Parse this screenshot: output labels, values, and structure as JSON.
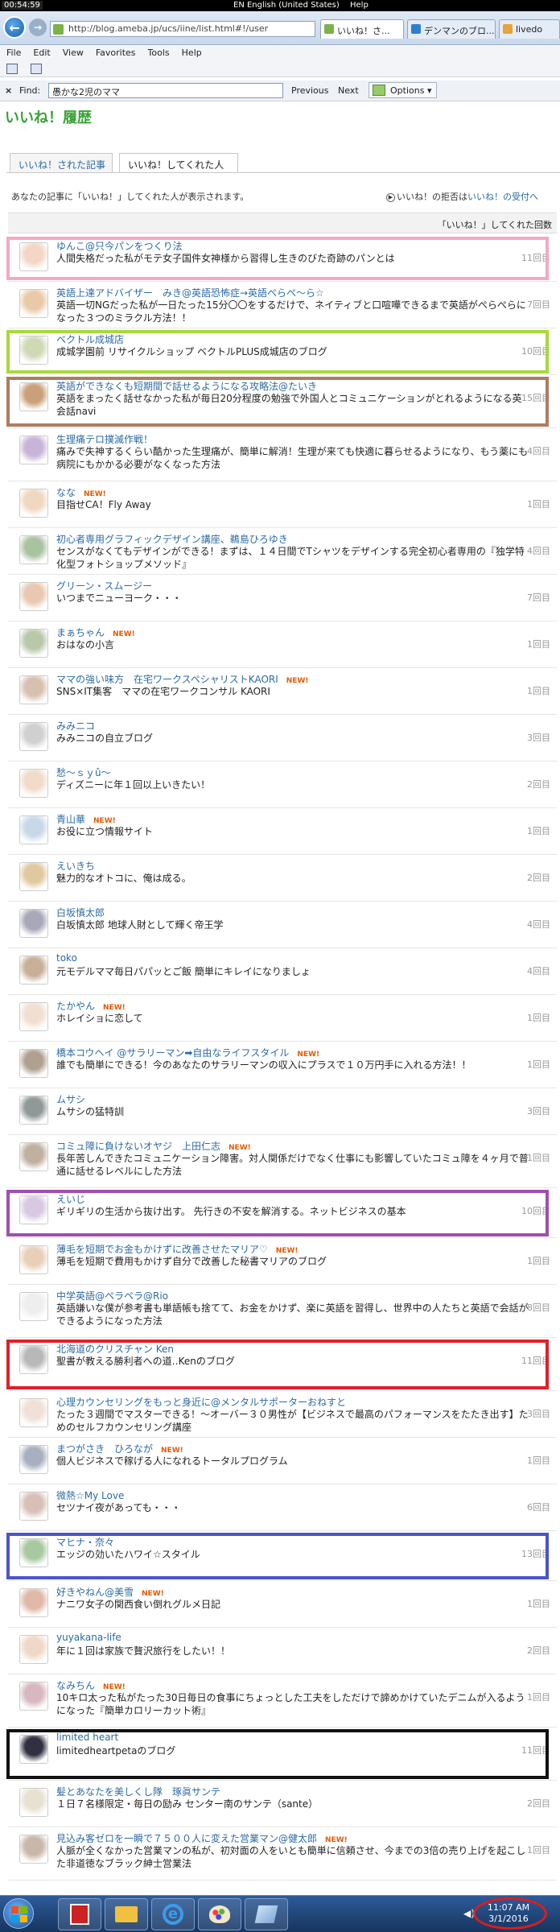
{
  "system": {
    "time_top": "00:54:59",
    "lang": "EN English (United States)",
    "help": "Help"
  },
  "browser": {
    "url": "http://blog.ameba.jp/ucs/iine/list.html#!/user",
    "tabs": [
      "いいね！さ...",
      "デンマンのブロ...",
      "livedo"
    ],
    "menu": [
      "File",
      "Edit",
      "View",
      "Favorites",
      "Tools",
      "Help"
    ],
    "find": {
      "label": "Find:",
      "value": "愚かな2児のママ",
      "previous": "Previous",
      "next": "Next",
      "options": "Options"
    }
  },
  "page": {
    "brand": "いいね！履歴",
    "tab_received": "いいね！された記事",
    "tab_given": "いいね！してくれた人",
    "description": "あなたの記事に「いいね！」してくれた人が表示されます。",
    "reject_prefix": "いいね！の拒否は",
    "reject_link": "いいね！の受付へ",
    "header_count": "「いいね！」してくれた回数"
  },
  "users": [
    {
      "name": "ゆんこ@只今パンをつくり法",
      "new": "",
      "text": "人間失格だった私がモテ女子国件女神様から習得し生きのびた奇跡のパンとは",
      "count": "11回目",
      "highlight": "#f4a8c4",
      "av": "#f3d6c6"
    },
    {
      "name": "英語上達アドバイザー　みき@英語恐怖症→英語ぺらぺ～ら☆",
      "new": "",
      "text": "英語一切NGだった私が一日たった15分〇〇をするだけで、ネイティブと口喧嘩できるまで英語がぺらぺらになった３つのミラクル方法！！",
      "count": "7回目",
      "highlight": "",
      "av": "#e9c9a8"
    },
    {
      "name": "ベクトル成城店",
      "new": "",
      "text": "成城学園前 リサイクルショップ ベクトルPLUS成城店のブログ",
      "count": "10回目",
      "highlight": "#a8d93b",
      "av": "#cfd9b6"
    },
    {
      "name": "英語ができなくも短期間で話せるようになる攻略法@たいき",
      "new": "",
      "text": "英語をまったく話せなかった私が毎日20分程度の勉強で外国人とコミュニケーションがとれるようになる英会話navi",
      "count": "15回目",
      "highlight": "#b07c5e",
      "av": "#c9a07a"
    },
    {
      "name": "生理痛テロ撲滅作戦！",
      "new": "",
      "text": "痛みで失神するくらい酷かった生理痛が、簡単に解消！生理が来ても快適に暮らせるようになり、もう薬にも病院にもかかる必要がなくなった方法",
      "count": "4回目",
      "highlight": "",
      "av": "#c8b4d8"
    },
    {
      "name": "なな",
      "new": "NEW!",
      "text": "目指せCA！Fly Away",
      "count": "1回目",
      "highlight": "",
      "av": "#f0d7c0"
    },
    {
      "name": "初心者専用グラフィックデザイン講座、鵜島ひろゆき",
      "new": "",
      "text": "センスがなくてもデザインができる！まずは、１４日間でTシャツをデザインする完全初心者専用の『独学特化型フォトショップメソッド』",
      "count": "4回目",
      "highlight": "",
      "av": "#a9c3a1"
    },
    {
      "name": "グリーン・スムージー",
      "new": "",
      "text": "いつまでニューヨーク・・・",
      "count": "7回目",
      "highlight": "",
      "av": "#e8c8b0"
    },
    {
      "name": "まぁちゃん",
      "new": "NEW!",
      "text": "おはなの小言",
      "count": "1回目",
      "highlight": "",
      "av": "#b8c8a8"
    },
    {
      "name": "ママの強い味方　在宅ワークスペシャリストKAORI",
      "new": "NEW!",
      "text": "SNS×IT集客　ママの在宅ワークコンサル KAORI",
      "count": "1回目",
      "highlight": "",
      "av": "#d8c0b0"
    },
    {
      "name": "みみニコ",
      "new": "",
      "text": "みみニコの自立ブログ",
      "count": "3回目",
      "highlight": "",
      "av": "#d0d0d0"
    },
    {
      "name": "愁～ｓｙû～",
      "new": "",
      "text": "ディズニーに年１回以上いきたい！",
      "count": "2回目",
      "highlight": "",
      "av": "#f0dcc8"
    },
    {
      "name": "青山華",
      "new": "NEW!",
      "text": "お役に立つ情報サイト",
      "count": "1回目",
      "highlight": "",
      "av": "#c8d8e8"
    },
    {
      "name": "えいきち",
      "new": "",
      "text": "魅力的なオトコに、俺は成る。",
      "count": "2回目",
      "highlight": "",
      "av": "#e0c8a0"
    },
    {
      "name": "白坂慎太郎",
      "new": "",
      "text": "白坂慎太郎 地球人財として輝く帝王学",
      "count": "4回目",
      "highlight": "",
      "av": "#a8a8b8"
    },
    {
      "name": "toko",
      "new": "",
      "text": "元モデルママ毎日パパッとご飯 簡単にキレイになりましょ",
      "count": "4回目",
      "highlight": "",
      "av": "#c8b098"
    },
    {
      "name": "たかやん",
      "new": "NEW!",
      "text": "ホレイショに恋して",
      "count": "1回目",
      "highlight": "",
      "av": "#f0e0d0"
    },
    {
      "name": "橋本コウヘイ @サラリーマン➡自由なライフスタイル",
      "new": "NEW!",
      "text": "誰でも簡単にできる！今のあなたのサラリーマンの収入にプラスで１０万円手に入れる方法！！",
      "count": "1回目",
      "highlight": "",
      "av": "#b0a090"
    },
    {
      "name": "ムサシ",
      "new": "",
      "text": "ムサシの猛特訓",
      "count": "3回目",
      "highlight": "",
      "av": "#909898"
    },
    {
      "name": "コミュ障に負けないオヤジ　上田仁志",
      "new": "NEW!",
      "text": "長年苦しんできたコミュニケーション障害。対人関係だけでなく仕事にも影響していたコミュ障を４ヶ月で普通に話せるレベルにした方法",
      "count": "1回目",
      "highlight": "",
      "av": "#c0b0a0"
    },
    {
      "name": "えいじ",
      "new": "",
      "text": "ギリギリの生活から抜け出す。 先行きの不安を解消する。ネットビジネスの基本",
      "count": "10回目",
      "highlight": "#a04fb0",
      "av": "#d8c8e0"
    },
    {
      "name": "薄毛を短期でお金もかけずに改善させたマリア♡",
      "new": "NEW!",
      "text": "薄毛を短期で費用もかけず自分で改善した秘書マリアのブログ",
      "count": "1回目",
      "highlight": "",
      "av": "#e8d0b8"
    },
    {
      "name": "中学英語@ペラペラ@Rio",
      "new": "",
      "text": "英語嫌いな僕が参考書も単語帳も捨てて、お金をかけず、楽に英語を習得し、世界中の人たちと英語で会話ができるようになった方法",
      "count": "8回目",
      "highlight": "",
      "av": "#eeeeee"
    },
    {
      "name": "北海道のクリスチャン Ken",
      "new": "",
      "text": "聖書が教える勝利者への道‥Kenのブログ",
      "count": "11回目",
      "highlight": "#e0202a",
      "av": "#b8b8b8"
    },
    {
      "name": "心理カウンセリングをもっと身近に@メンタルサポーターおねすと",
      "new": "",
      "text": "たった３週間でマスターできる！～オーバー３０男性が【ビジネスで最高のパフォーマンスをたたき出す】ためのセルフカウンセリング講座",
      "count": "3回目",
      "highlight": "",
      "av": "#f0e0d8"
    },
    {
      "name": "まつがさき　ひろなが",
      "new": "NEW!",
      "text": "個人ビジネスで稼げる人になれるトータルプログラム",
      "count": "1回目",
      "highlight": "",
      "av": "#a8b0c0"
    },
    {
      "name": "微熱☆My Love",
      "new": "",
      "text": "セツナイ夜があっても・・・",
      "count": "6回目",
      "highlight": "",
      "av": "#d8c0b8"
    },
    {
      "name": "マヒナ・奈々",
      "new": "",
      "text": "エッジの効いたハワイ☆スタイル",
      "count": "13回目",
      "highlight": "#4a55c8",
      "av": "#a8c8a0"
    },
    {
      "name": "好きやねん@美雪",
      "new": "NEW!",
      "text": "ナニワ女子の関西食い倒れグルメ日記",
      "count": "1回目",
      "highlight": "",
      "av": "#e0b8a8"
    },
    {
      "name": "yuyakana-life",
      "new": "",
      "text": "年に１回は家族で贅沢旅行をしたい！！",
      "count": "2回目",
      "highlight": "",
      "av": "#f0d8c8"
    },
    {
      "name": "なみちん",
      "new": "NEW!",
      "text": "10キロ太った私がたった30日毎日の食事にちょっとした工夫をしただけで諦めかけていたデニムが入るようになった『簡単カロリーカット術』",
      "count": "1回目",
      "highlight": "",
      "av": "#d8b8c0"
    },
    {
      "name": "limited heart",
      "new": "",
      "text": "limitedheartpetaのブログ",
      "count": "11回目",
      "highlight": "#111111",
      "av": "#303040"
    },
    {
      "name": "髪とあなたを美しくし隊　琢眞サンテ",
      "new": "",
      "text": "１日７名様限定・毎日の励み センター南のサンテ（sante）",
      "count": "2回目",
      "highlight": "",
      "av": "#e8e0d0"
    },
    {
      "name": "見込み客ゼロを一瞬で７５００人に変えた営業マン@健太郎",
      "new": "NEW!",
      "text": "人脈が全くなかった営業マンの私が、初対面の人をいとも簡単に信頼させ、今までの3倍の売り上げを起こした非道徳なブラック紳士営業法",
      "count": "1回目",
      "highlight": "",
      "av": "#c8b8a8"
    }
  ],
  "taskbar": {
    "clock_time": "11:07 AM",
    "clock_date": "3/1/2016"
  }
}
